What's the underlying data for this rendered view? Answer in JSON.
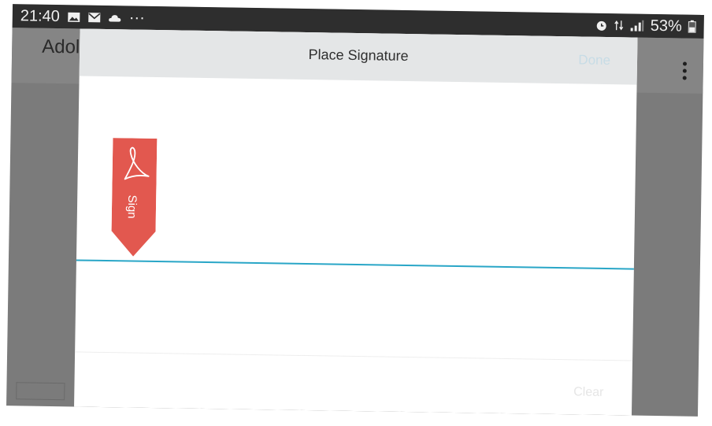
{
  "status_bar": {
    "time": "21:40",
    "left_icons": [
      "gallery-icon",
      "mail-icon",
      "cloud-icon"
    ],
    "more": "···",
    "battery": "53%",
    "right_icons": [
      "alarm-icon",
      "data-icon",
      "signal-icon",
      "battery-icon"
    ]
  },
  "app": {
    "title": "Adol"
  },
  "dialog": {
    "title": "Place Signature",
    "done_label": "Done",
    "clear_label": "Clear",
    "sign_tag_label": "Sign",
    "colors": {
      "sign_tag": "#e2584f",
      "signature_line": "#29a6c7",
      "header": "#e4e6e7"
    }
  }
}
